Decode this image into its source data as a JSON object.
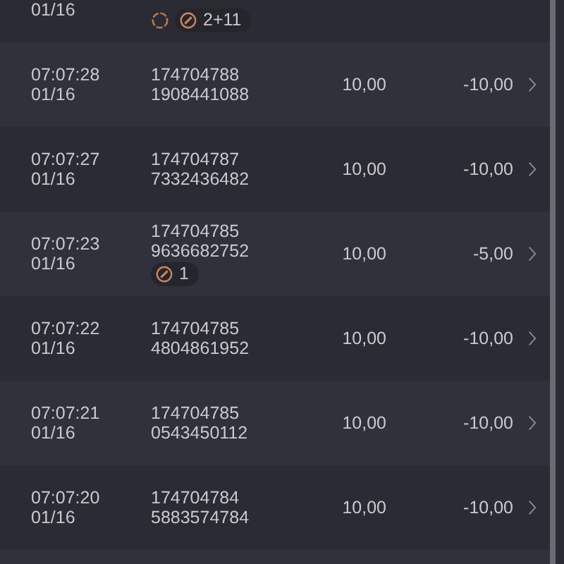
{
  "rows": [
    {
      "date": "01/16",
      "spinner": true,
      "badge": "2+11"
    },
    {
      "time": "07:07:28",
      "date": "01/16",
      "order": "174704788",
      "serial": "1908441088",
      "amount": "10,00",
      "result": "-10,00"
    },
    {
      "time": "07:07:27",
      "date": "01/16",
      "order": "174704787",
      "serial": "7332436482",
      "amount": "10,00",
      "result": "-10,00"
    },
    {
      "time": "07:07:23",
      "date": "01/16",
      "order": "174704785",
      "serial": "9636682752",
      "badge": "1",
      "amount": "10,00",
      "result": "-5,00"
    },
    {
      "time": "07:07:22",
      "date": "01/16",
      "order": "174704785",
      "serial": "4804861952",
      "amount": "10,00",
      "result": "-10,00"
    },
    {
      "time": "07:07:21",
      "date": "01/16",
      "order": "174704785",
      "serial": "0543450112",
      "amount": "10,00",
      "result": "-10,00"
    },
    {
      "time": "07:07:20",
      "date": "01/16",
      "order": "174704784",
      "serial": "5883574784",
      "amount": "10,00",
      "result": "-10,00"
    }
  ]
}
